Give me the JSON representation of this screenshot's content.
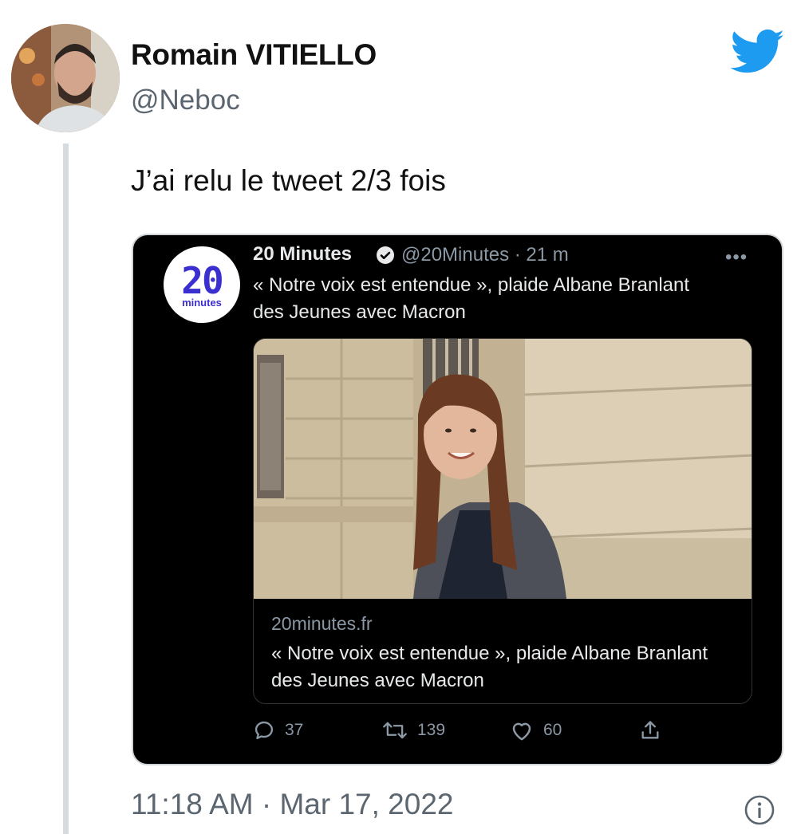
{
  "author": {
    "name": "Romain VITIELLO",
    "handle": "@Neboc"
  },
  "tweet": {
    "text": "J’ai relu le tweet 2/3 fois",
    "timestamp": "11:18 AM · Mar 17, 2022"
  },
  "quoted": {
    "name": "20 Minutes",
    "handle": "@20Minutes",
    "time": "· 21 m",
    "more": "•••",
    "logo": {
      "big": "20",
      "small": "minutes"
    },
    "text": "« Notre voix est entendue », plaide Albane Branlant des Jeunes avec Macron",
    "link": {
      "domain": "20minutes.fr",
      "title": "« Notre voix est entendue », plaide Albane Branlant des Jeunes avec Macron"
    },
    "actions": {
      "replies": "37",
      "retweets": "139",
      "likes": "60"
    }
  },
  "colors": {
    "twitter_blue": "#1d9bf0",
    "logo_purple": "#3b2fd0"
  }
}
